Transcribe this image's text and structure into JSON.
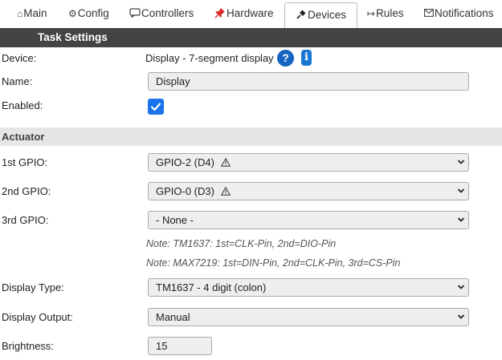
{
  "tabs": [
    {
      "label": "Main",
      "icon": "home-icon",
      "glyph": "⌂"
    },
    {
      "label": "Config",
      "icon": "gear-icon",
      "glyph": "⚙"
    },
    {
      "label": "Controllers",
      "icon": "chat-icon",
      "glyph": "💬"
    },
    {
      "label": "Hardware",
      "icon": "pin-icon",
      "glyph": "📌"
    },
    {
      "label": "Devices",
      "icon": "plug-icon",
      "glyph": "✎"
    },
    {
      "label": "Rules",
      "icon": "arrow-icon",
      "glyph": "↦"
    },
    {
      "label": "Notifications",
      "icon": "envelope-icon",
      "glyph": "✉"
    }
  ],
  "active_tab": "Devices",
  "section_header": "Task Settings",
  "form": {
    "device_label": "Device:",
    "device_value": "Display - 7-segment display",
    "help_glyph": "?",
    "info_glyph": "i",
    "name_label": "Name:",
    "name_value": "Display",
    "enabled_label": "Enabled:",
    "enabled_checked": true
  },
  "actuator": {
    "title": "Actuator",
    "gpio1_label": "1st GPIO:",
    "gpio1_value": "GPIO-2 (D4)",
    "gpio1_warning": true,
    "gpio2_label": "2nd GPIO:",
    "gpio2_value": "GPIO-0 (D3)",
    "gpio2_warning": true,
    "gpio3_label": "3rd GPIO:",
    "gpio3_value": "- None -",
    "note1": "Note: TM1637: 1st=CLK-Pin, 2nd=DIO-Pin",
    "note2": "Note: MAX7219: 1st=DIN-Pin, 2nd=CLK-Pin, 3rd=CS-Pin",
    "display_type_label": "Display Type:",
    "display_type_value": "TM1637 - 4 digit (colon)",
    "display_output_label": "Display Output:",
    "display_output_value": "Manual",
    "brightness_label": "Brightness:",
    "brightness_value": "15"
  },
  "colors": {
    "header_bg": "#444444",
    "section_bg": "#e6e6e6",
    "accent": "#1a73e8"
  }
}
